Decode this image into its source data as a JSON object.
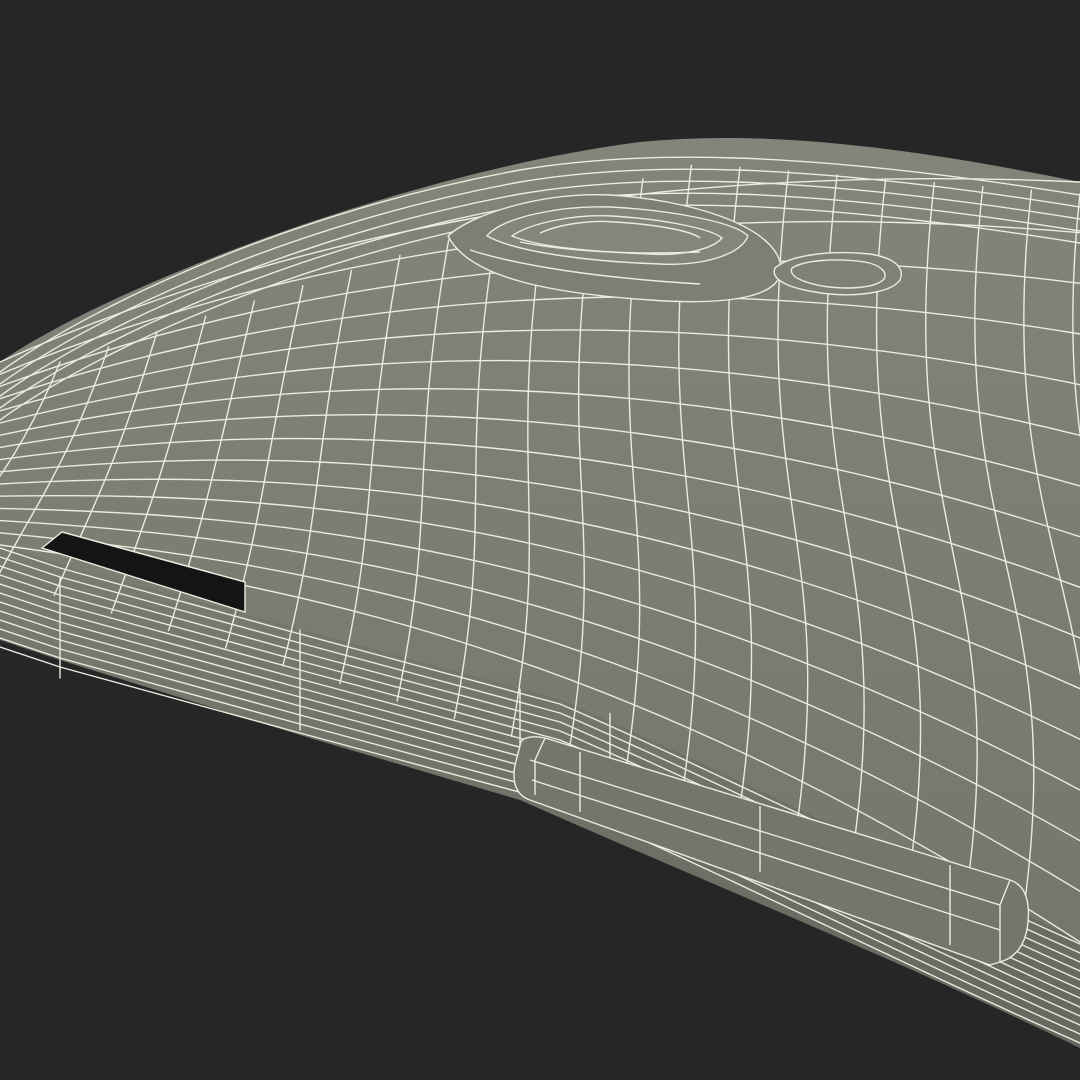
{
  "image": {
    "subject": "phone-back-wireframe-render",
    "colors": {
      "background": "#262626",
      "mesh_fill": "#797a70",
      "mesh_fill_dark": "#6a6b62",
      "wire": "#ecebe0",
      "slot": "#141414"
    }
  }
}
